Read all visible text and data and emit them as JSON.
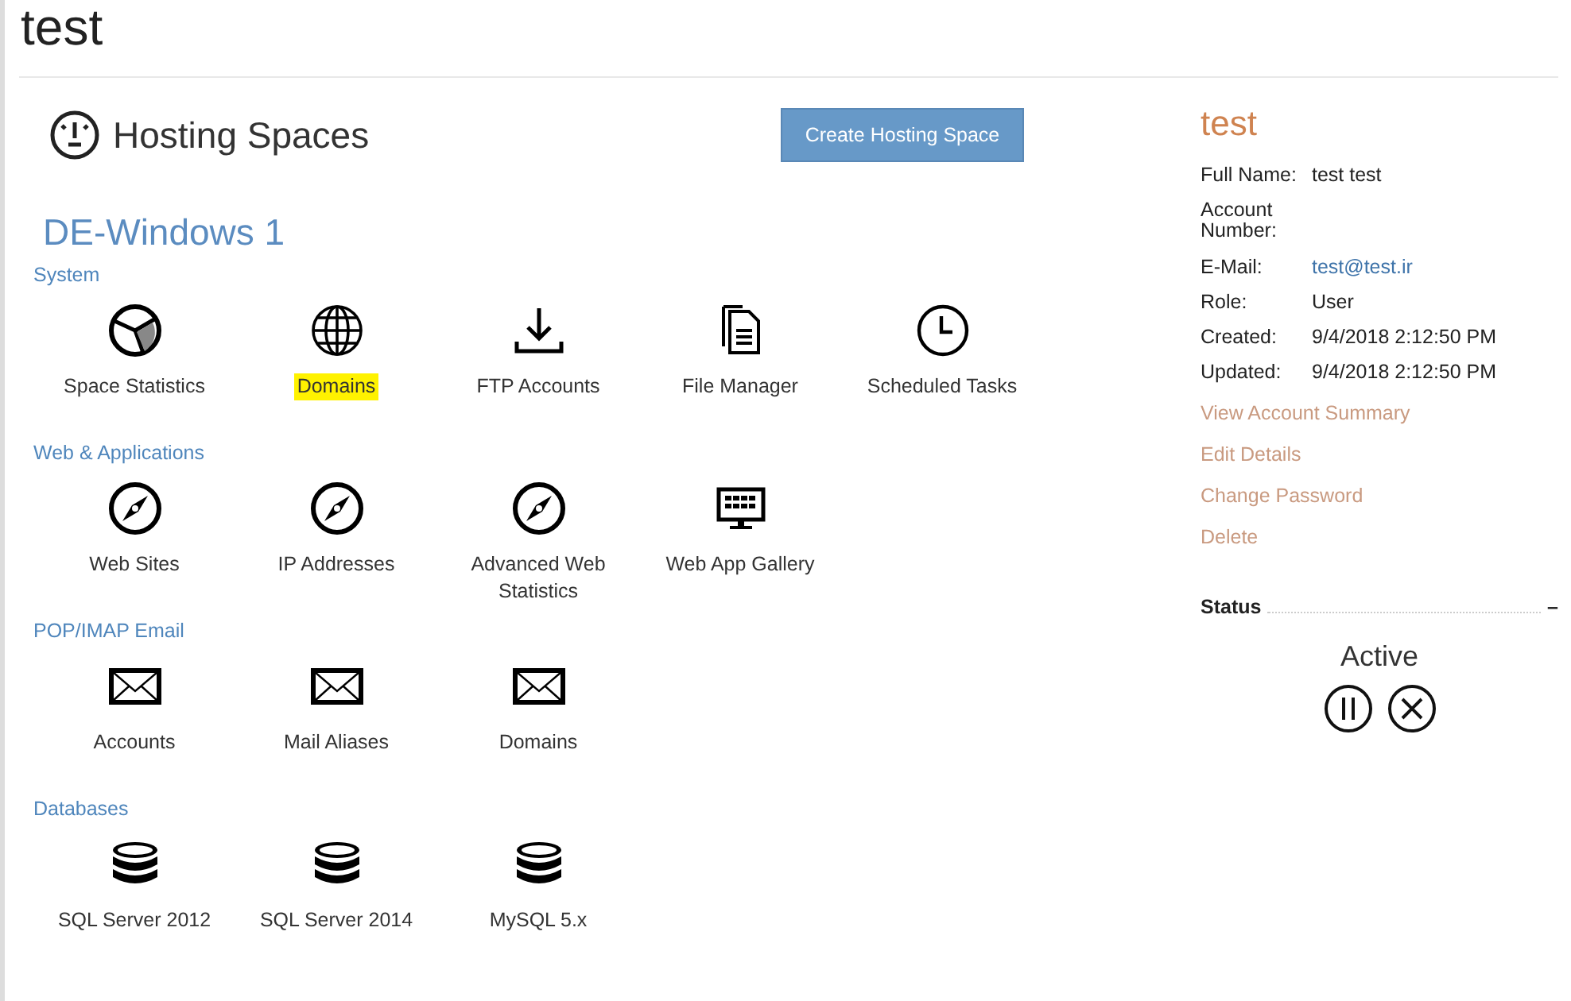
{
  "page": {
    "title": "test"
  },
  "hosting": {
    "heading": "Hosting Spaces",
    "create_button": "Create Hosting Space",
    "space_name": "DE-Windows 1",
    "sections": [
      {
        "title": "System",
        "items": [
          {
            "label": "Space Statistics",
            "kind": "pie",
            "highlighted": false
          },
          {
            "label": "Domains",
            "kind": "globe",
            "highlighted": true
          },
          {
            "label": "FTP Accounts",
            "kind": "download",
            "highlighted": false
          },
          {
            "label": "File Manager",
            "kind": "file",
            "highlighted": false
          },
          {
            "label": "Scheduled Tasks",
            "kind": "clock",
            "highlighted": false
          }
        ]
      },
      {
        "title": "Web & Applications",
        "items": [
          {
            "label": "Web Sites",
            "kind": "compass",
            "highlighted": false
          },
          {
            "label": "IP Addresses",
            "kind": "compass",
            "highlighted": false
          },
          {
            "label": "Advanced Web Statistics",
            "kind": "compass",
            "highlighted": false
          },
          {
            "label": "Web App Gallery",
            "kind": "monitor",
            "highlighted": false
          }
        ]
      },
      {
        "title": "POP/IMAP Email",
        "items": [
          {
            "label": "Accounts",
            "kind": "mail",
            "highlighted": false
          },
          {
            "label": "Mail Aliases",
            "kind": "mail",
            "highlighted": false
          },
          {
            "label": "Domains",
            "kind": "mail",
            "highlighted": false
          }
        ]
      },
      {
        "title": "Databases",
        "items": [
          {
            "label": "SQL Server 2012",
            "kind": "database",
            "highlighted": false
          },
          {
            "label": "SQL Server 2014",
            "kind": "database",
            "highlighted": false
          },
          {
            "label": "MySQL 5.x",
            "kind": "database",
            "highlighted": false
          }
        ]
      }
    ]
  },
  "account": {
    "name": "test",
    "fields": [
      {
        "label": "Full Name:",
        "value": "test test",
        "kind": "text"
      },
      {
        "label": "Account Number:",
        "kind": "text"
      },
      {
        "label": "E-Mail:",
        "value": "test@test.ir",
        "kind": "link"
      },
      {
        "label": "Role:",
        "value": "User",
        "kind": "text"
      },
      {
        "label": "Created:",
        "value": "9/4/2018 2:12:50 PM",
        "kind": "text"
      },
      {
        "label": "Updated:",
        "value": "9/4/2018 2:12:50 PM",
        "kind": "text"
      }
    ],
    "links": [
      "View Account Summary",
      "Edit Details",
      "Change Password",
      "Delete"
    ],
    "status": {
      "title": "Status",
      "toggle": "–",
      "value": "Active"
    }
  }
}
